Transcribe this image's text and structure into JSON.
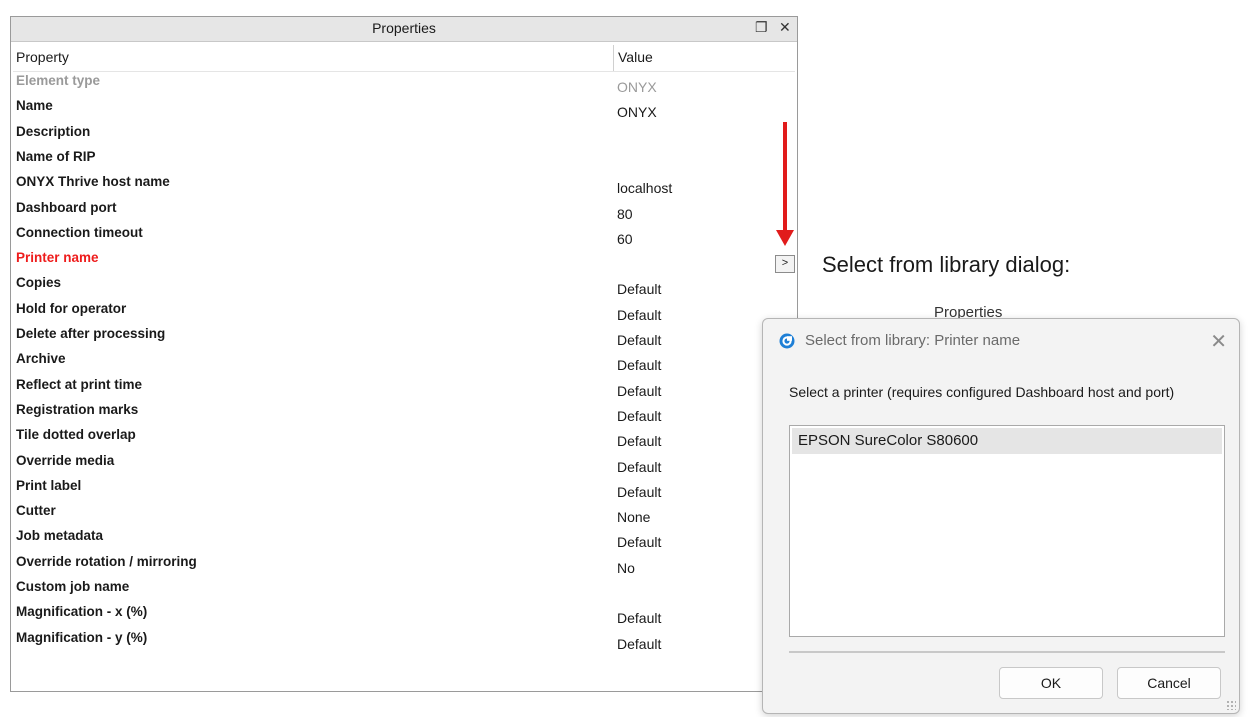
{
  "panel": {
    "title": "Properties",
    "float_icon": "❐",
    "close_icon": "✕",
    "col_property": "Property",
    "col_value": "Value",
    "rows": [
      {
        "name": "Element type",
        "value": "ONYX",
        "state": "disabled"
      },
      {
        "name": "Name",
        "value": "ONYX",
        "state": "normal"
      },
      {
        "name": "Description",
        "value": "",
        "state": "normal"
      },
      {
        "name": "Name of RIP",
        "value": "",
        "state": "normal"
      },
      {
        "name": "ONYX Thrive host name",
        "value": "localhost",
        "state": "normal"
      },
      {
        "name": "Dashboard port",
        "value": "80",
        "state": "normal"
      },
      {
        "name": "Connection timeout",
        "value": "60",
        "state": "normal"
      },
      {
        "name": "Printer name",
        "value": "",
        "state": "required"
      },
      {
        "name": "Copies",
        "value": "Default",
        "state": "normal"
      },
      {
        "name": "Hold for operator",
        "value": "Default",
        "state": "normal"
      },
      {
        "name": "Delete after processing",
        "value": "Default",
        "state": "normal"
      },
      {
        "name": "Archive",
        "value": "Default",
        "state": "normal"
      },
      {
        "name": "Reflect at print time",
        "value": "Default",
        "state": "normal"
      },
      {
        "name": "Registration marks",
        "value": "Default",
        "state": "normal"
      },
      {
        "name": "Tile dotted overlap",
        "value": "Default",
        "state": "normal"
      },
      {
        "name": "Override media",
        "value": "Default",
        "state": "normal"
      },
      {
        "name": "Print label",
        "value": "Default",
        "state": "normal"
      },
      {
        "name": "Cutter",
        "value": "None",
        "state": "normal"
      },
      {
        "name": "Job metadata",
        "value": "Default",
        "state": "normal"
      },
      {
        "name": "Override rotation / mirroring",
        "value": "No",
        "state": "normal"
      },
      {
        "name": "Custom job name",
        "value": "",
        "state": "normal"
      },
      {
        "name": "Magnification - x  (%)",
        "value": "Default",
        "state": "normal"
      },
      {
        "name": "Magnification - y (%)",
        "value": "Default",
        "state": "normal"
      }
    ]
  },
  "annotation": {
    "button_label": ">",
    "caption": "Select from library dialog:",
    "arrow_color": "#e11b1b"
  },
  "background_fragments": {
    "properties_label": "Properties",
    "frag1": "r",
    "frag2": "i",
    "frag3": "si"
  },
  "dialog": {
    "title": "Select from library: Printer name",
    "prompt": "Select a printer (requires configured Dashboard host and port)",
    "items": [
      "EPSON SureColor S80600"
    ],
    "ok_label": "OK",
    "cancel_label": "Cancel",
    "close_icon": "✕"
  }
}
